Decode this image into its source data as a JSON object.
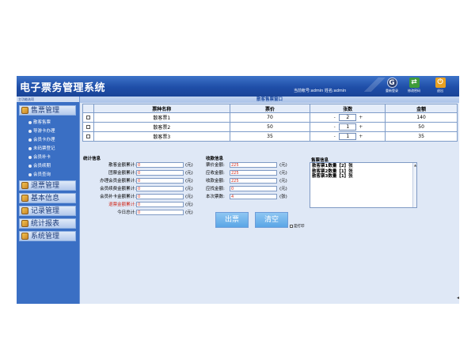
{
  "header": {
    "title": "电子票务管理系统",
    "user_info": "当前帐号:admin  姓名:admin",
    "buttons": [
      {
        "label": "重新登录",
        "icon": "relogin-icon"
      },
      {
        "label": "修改密码",
        "icon": "password-icon"
      },
      {
        "label": "退出",
        "icon": "exit-icon"
      }
    ],
    "colors": {
      "bar": "#1f4ea8",
      "accent": "#3a6fc4"
    }
  },
  "sidebar": {
    "title": "主功能选项",
    "sales_menu": "售票管理",
    "sub_items": [
      "散客售票",
      "导游卡办理",
      "会员卡办理",
      "未码票登记",
      "会员补卡",
      "会员续期",
      "会员查询"
    ],
    "menus": [
      "退票管理",
      "基本信息",
      "记录管理",
      "统计报表",
      "系统管理"
    ]
  },
  "main": {
    "window_title": "散客售票窗口",
    "table": {
      "headers": [
        "票种名称",
        "票价",
        "张数",
        "金额"
      ],
      "rows": [
        {
          "name": "散客票1",
          "price": "70",
          "qty": "2",
          "amount": "140"
        },
        {
          "name": "散客票2",
          "price": "50",
          "qty": "1",
          "amount": "50"
        },
        {
          "name": "散客票3",
          "price": "35",
          "qty": "1",
          "amount": "35"
        }
      ],
      "minus": "-",
      "plus": "+"
    },
    "stats": {
      "label": "统计信息",
      "fields": [
        {
          "label": "散客金额累计:",
          "value": "0",
          "unit": "(元)"
        },
        {
          "label": "团票金额累计:",
          "value": "0",
          "unit": "(元)"
        },
        {
          "label": "办理会员金额累计:",
          "value": "0",
          "unit": "(元)"
        },
        {
          "label": "会员续费金额累计:",
          "value": "0",
          "unit": "(元)"
        },
        {
          "label": "会员补卡金额累计:",
          "value": "0",
          "unit": "(元)"
        },
        {
          "label": "退票金额累计:",
          "value": "0",
          "unit": "(元)"
        },
        {
          "label": "今日总计:",
          "value": "0",
          "unit": "(元)"
        }
      ]
    },
    "payment": {
      "label": "收款信息",
      "fields": [
        {
          "label": "票价金额:",
          "value": "225",
          "unit": "(元)"
        },
        {
          "label": "应收金额:",
          "value": "225",
          "unit": "(元)"
        },
        {
          "label": "收款金额:",
          "value": "225",
          "unit": "(元)"
        },
        {
          "label": "应找金额:",
          "value": "0",
          "unit": "(元)"
        },
        {
          "label": "本次票数:",
          "value": "4",
          "unit": "(张)"
        }
      ]
    },
    "buttons": {
      "issue": "出票",
      "clear": "清空"
    },
    "print_option": "是打印",
    "sale_info": {
      "label": "售票信息",
      "lines": [
        "散客票1数量【2】张",
        "散客票2数量【1】张",
        "散客票3数量【1】张"
      ]
    }
  }
}
